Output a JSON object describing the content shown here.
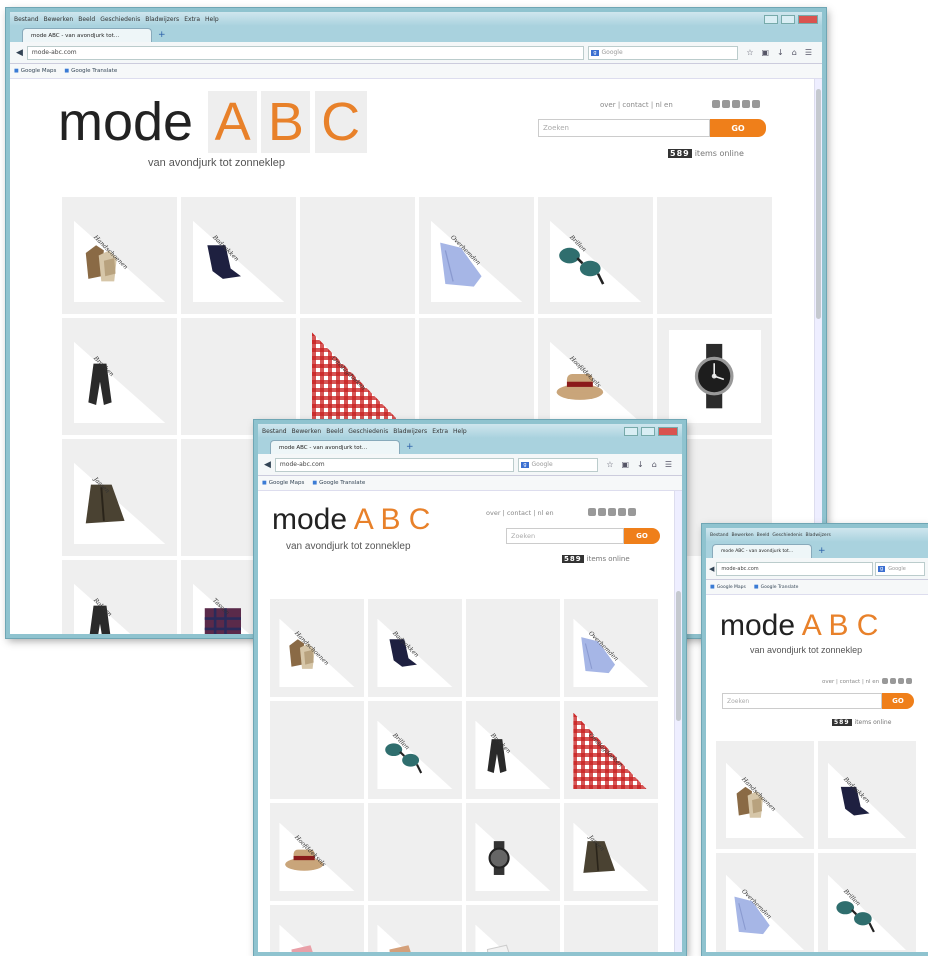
{
  "browser": {
    "menu": [
      "Bestand",
      "Bewerken",
      "Beeld",
      "Geschiedenis",
      "Bladwijzers",
      "Extra",
      "Help"
    ],
    "tab_title": "mode ABC - van avondjurk tot...",
    "new_tab": "+",
    "url": "mode-abc.com",
    "search_engine": "Google",
    "bookmarks": [
      "Google Maps",
      "Google Translate"
    ]
  },
  "site": {
    "logo_word": "mode",
    "logo_letters": [
      "A",
      "B",
      "C"
    ],
    "tagline": "van avondjurk tot zonneklep",
    "toplinks": "over | contact | nl en",
    "search_placeholder": "Zoeken",
    "search_button": "GO",
    "item_count": "589",
    "items_suffix": "items online",
    "accent_color": "#ef7f1a"
  },
  "tiles": [
    {
      "label": "Handschoenen",
      "kind": "gloves"
    },
    {
      "label": "Badpakken",
      "kind": "swimsuit"
    },
    {
      "label": "",
      "kind": "empty"
    },
    {
      "label": "Overhemden",
      "kind": "shirt"
    },
    {
      "label": "Brillen",
      "kind": "glasses"
    },
    {
      "label": "",
      "kind": "empty"
    },
    {
      "label": "Broeken",
      "kind": "pants"
    },
    {
      "label": "",
      "kind": "empty"
    },
    {
      "label": "Omslagdoeken",
      "kind": "gingham"
    },
    {
      "label": "",
      "kind": "empty"
    },
    {
      "label": "Hoofddeksels",
      "kind": "hat"
    },
    {
      "label": "",
      "kind": "watch"
    },
    {
      "label": "Jassen",
      "kind": "jacket"
    },
    {
      "label": "",
      "kind": "empty"
    },
    {
      "label": "",
      "kind": "empty"
    },
    {
      "label": "",
      "kind": "empty"
    },
    {
      "label": "",
      "kind": "empty"
    },
    {
      "label": "",
      "kind": "empty"
    },
    {
      "label": "Rokken",
      "kind": "pants"
    },
    {
      "label": "Tassen",
      "kind": "plaid"
    }
  ],
  "tiles_mid": [
    {
      "label": "Handschoenen",
      "kind": "gloves"
    },
    {
      "label": "Badpakken",
      "kind": "swimsuit"
    },
    {
      "label": "",
      "kind": "empty"
    },
    {
      "label": "Overhemden",
      "kind": "shirt"
    },
    {
      "label": "",
      "kind": "empty"
    },
    {
      "label": "Brillen",
      "kind": "glasses"
    },
    {
      "label": "Broeken",
      "kind": "pants"
    },
    {
      "label": "Omslagdoeken",
      "kind": "gingham"
    },
    {
      "label": "Hoofddeksels",
      "kind": "hat"
    },
    {
      "label": "",
      "kind": "empty"
    },
    {
      "label": "",
      "kind": "watchsmall"
    },
    {
      "label": "Jassen",
      "kind": "jacket"
    },
    {
      "label": "",
      "kind": "pink"
    },
    {
      "label": "",
      "kind": "tan"
    },
    {
      "label": "",
      "kind": "white"
    },
    {
      "label": "",
      "kind": "empty"
    }
  ],
  "tiles_small": [
    {
      "label": "Handschoenen",
      "kind": "gloves"
    },
    {
      "label": "Badpakken",
      "kind": "swimsuit"
    },
    {
      "label": "Overhemden",
      "kind": "shirt"
    },
    {
      "label": "Brillen",
      "kind": "glasses"
    }
  ]
}
